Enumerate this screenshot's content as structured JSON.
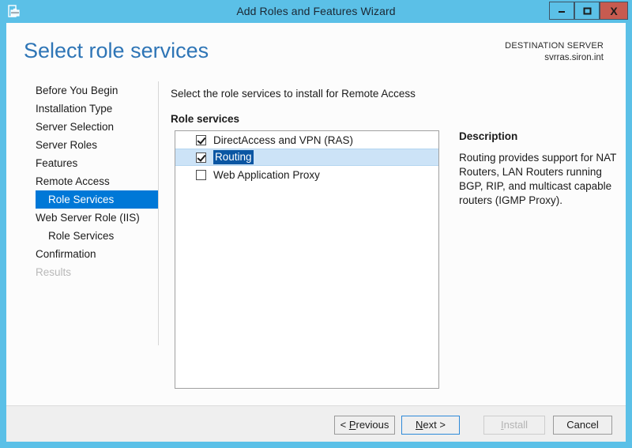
{
  "window": {
    "title": "Add Roles and Features Wizard",
    "icon": "wizard-briefcase-icon",
    "controls": {
      "minimize": "minimize-icon",
      "maximize": "maximize-icon",
      "close": "X"
    },
    "frame_color": "#5bc0e7",
    "close_color": "#c75b50"
  },
  "header": {
    "page_title": "Select role services",
    "destination_label": "DESTINATION SERVER",
    "destination_server": "svrras.siron.int",
    "title_color": "#2e75b6"
  },
  "sidebar": {
    "selected_index": 6,
    "highlight_color": "#0078d7",
    "items": [
      {
        "label": "Before You Begin",
        "indent": false,
        "selected": false,
        "disabled": false
      },
      {
        "label": "Installation Type",
        "indent": false,
        "selected": false,
        "disabled": false
      },
      {
        "label": "Server Selection",
        "indent": false,
        "selected": false,
        "disabled": false
      },
      {
        "label": "Server Roles",
        "indent": false,
        "selected": false,
        "disabled": false
      },
      {
        "label": "Features",
        "indent": false,
        "selected": false,
        "disabled": false
      },
      {
        "label": "Remote Access",
        "indent": false,
        "selected": false,
        "disabled": false
      },
      {
        "label": "Role Services",
        "indent": true,
        "selected": true,
        "disabled": false
      },
      {
        "label": "Web Server Role (IIS)",
        "indent": false,
        "selected": false,
        "disabled": false
      },
      {
        "label": "Role Services",
        "indent": true,
        "selected": false,
        "disabled": false
      },
      {
        "label": "Confirmation",
        "indent": false,
        "selected": false,
        "disabled": false
      },
      {
        "label": "Results",
        "indent": false,
        "selected": false,
        "disabled": true
      }
    ]
  },
  "main": {
    "instruction": "Select the role services to install for Remote Access",
    "list_label": "Role services",
    "row_selected_bg": "#cce3f7",
    "text_selected_bg": "#0a56a3",
    "role_services": [
      {
        "label": "DirectAccess and VPN (RAS)",
        "checked": true,
        "selected": false
      },
      {
        "label": "Routing",
        "checked": true,
        "selected": true
      },
      {
        "label": "Web Application Proxy",
        "checked": false,
        "selected": false
      }
    ]
  },
  "description": {
    "title": "Description",
    "body": "Routing provides support for NAT Routers, LAN Routers running BGP, RIP, and multicast capable routers (IGMP Proxy)."
  },
  "footer": {
    "buttons": [
      {
        "id": "previous",
        "prefix": "< ",
        "accel": "P",
        "rest": "revious",
        "suffix": "",
        "disabled": false,
        "focused": false
      },
      {
        "id": "next",
        "prefix": "",
        "accel": "N",
        "rest": "ext",
        "suffix": " >",
        "disabled": false,
        "focused": true
      },
      {
        "id": "install",
        "prefix": "",
        "accel": "I",
        "rest": "nstall",
        "suffix": "",
        "disabled": true,
        "focused": false
      },
      {
        "id": "cancel",
        "prefix": "",
        "accel": "",
        "rest": "Cancel",
        "suffix": "",
        "disabled": false,
        "focused": false
      }
    ]
  }
}
